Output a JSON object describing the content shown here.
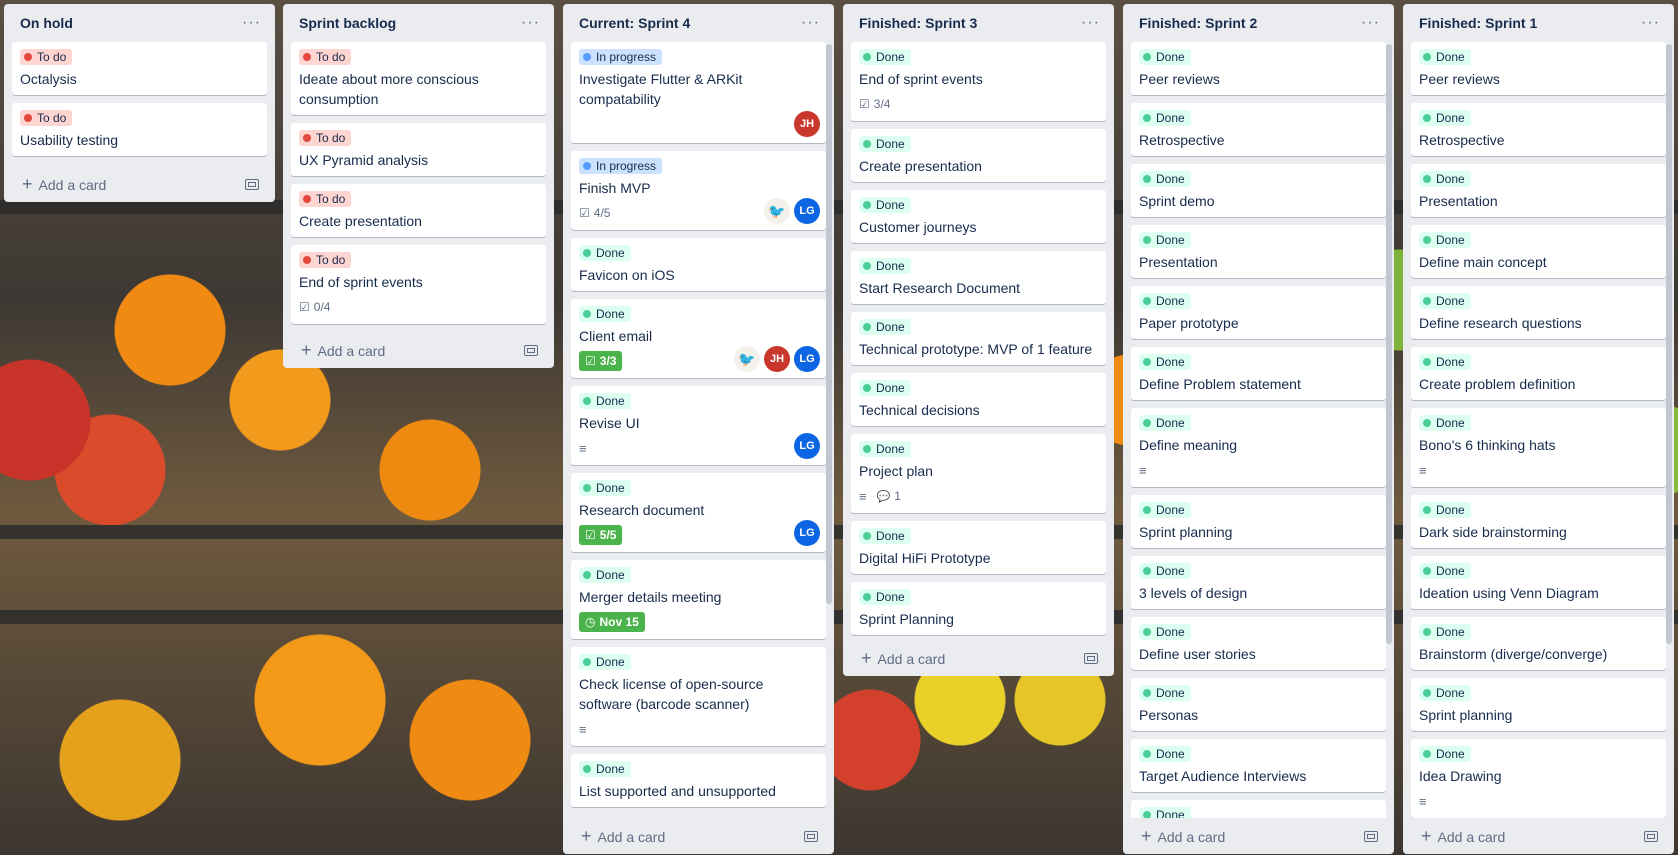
{
  "lists": [
    {
      "title": "On hold",
      "add_card": "Add a card",
      "cards": [
        {
          "label": "To do",
          "label_type": "todo",
          "title": "Octalysis"
        },
        {
          "label": "To do",
          "label_type": "todo",
          "title": "Usability testing"
        }
      ]
    },
    {
      "title": "Sprint backlog",
      "add_card": "Add a card",
      "cards": [
        {
          "label": "To do",
          "label_type": "todo",
          "title": "Ideate about more conscious consumption"
        },
        {
          "label": "To do",
          "label_type": "todo",
          "title": "UX Pyramid analysis"
        },
        {
          "label": "To do",
          "label_type": "todo",
          "title": "Create presentation"
        },
        {
          "label": "To do",
          "label_type": "todo",
          "title": "End of sprint events",
          "checklist": "0/4"
        }
      ]
    },
    {
      "title": "Current: Sprint 4",
      "add_card": "Add a card",
      "cards": [
        {
          "label": "In progress",
          "label_type": "prog",
          "title": "Investigate Flutter & ARKit compatability",
          "members": [
            "JH"
          ]
        },
        {
          "label": "In progress",
          "label_type": "prog",
          "title": "Finish MVP",
          "checklist": "4/5",
          "members": [
            "bird",
            "LG"
          ]
        },
        {
          "label": "Done",
          "label_type": "done",
          "title": "Favicon on iOS"
        },
        {
          "label": "Done",
          "label_type": "done",
          "title": "Client email",
          "checklist_complete": "3/3",
          "members": [
            "bird",
            "JH",
            "LG"
          ]
        },
        {
          "label": "Done",
          "label_type": "done",
          "title": "Revise UI",
          "description": true,
          "members": [
            "LG"
          ]
        },
        {
          "label": "Done",
          "label_type": "done",
          "title": "Research document",
          "checklist_complete": "5/5",
          "members": [
            "LG"
          ]
        },
        {
          "label": "Done",
          "label_type": "done",
          "title": "Merger details meeting",
          "due": "Nov 15"
        },
        {
          "label": "Done",
          "label_type": "done",
          "title": "Check license of open-source software (barcode scanner)",
          "description": true
        },
        {
          "label": "Done",
          "label_type": "done",
          "title": "List supported and unsupported"
        }
      ]
    },
    {
      "title": "Finished: Sprint 3",
      "add_card": "Add a card",
      "cards": [
        {
          "label": "Done",
          "label_type": "done",
          "title": "End of sprint events",
          "checklist": "3/4"
        },
        {
          "label": "Done",
          "label_type": "done",
          "title": "Create presentation"
        },
        {
          "label": "Done",
          "label_type": "done",
          "title": "Customer journeys"
        },
        {
          "label": "Done",
          "label_type": "done",
          "title": "Start Research Document"
        },
        {
          "label": "Done",
          "label_type": "done",
          "title": "Technical prototype: MVP of 1 feature"
        },
        {
          "label": "Done",
          "label_type": "done",
          "title": "Technical decisions"
        },
        {
          "label": "Done",
          "label_type": "done",
          "title": "Project plan",
          "description": true,
          "comments": "1"
        },
        {
          "label": "Done",
          "label_type": "done",
          "title": "Digital HiFi Prototype"
        },
        {
          "label": "Done",
          "label_type": "done",
          "title": "Sprint Planning"
        }
      ]
    },
    {
      "title": "Finished: Sprint 2",
      "add_card": "Add a card",
      "cards": [
        {
          "label": "Done",
          "label_type": "done",
          "title": "Peer reviews"
        },
        {
          "label": "Done",
          "label_type": "done",
          "title": "Retrospective"
        },
        {
          "label": "Done",
          "label_type": "done",
          "title": "Sprint demo"
        },
        {
          "label": "Done",
          "label_type": "done",
          "title": "Presentation"
        },
        {
          "label": "Done",
          "label_type": "done",
          "title": "Paper prototype"
        },
        {
          "label": "Done",
          "label_type": "done",
          "title": "Define Problem statement"
        },
        {
          "label": "Done",
          "label_type": "done",
          "title": "Define meaning",
          "description": true
        },
        {
          "label": "Done",
          "label_type": "done",
          "title": "Sprint planning"
        },
        {
          "label": "Done",
          "label_type": "done",
          "title": "3 levels of design"
        },
        {
          "label": "Done",
          "label_type": "done",
          "title": "Define user stories"
        },
        {
          "label": "Done",
          "label_type": "done",
          "title": "Personas"
        },
        {
          "label": "Done",
          "label_type": "done",
          "title": "Target Audience Interviews"
        },
        {
          "label": "Done",
          "label_type": "done",
          "title": ""
        }
      ]
    },
    {
      "title": "Finished: Sprint 1",
      "add_card": "Add a card",
      "cards": [
        {
          "label": "Done",
          "label_type": "done",
          "title": "Peer reviews"
        },
        {
          "label": "Done",
          "label_type": "done",
          "title": "Retrospective"
        },
        {
          "label": "Done",
          "label_type": "done",
          "title": "Presentation"
        },
        {
          "label": "Done",
          "label_type": "done",
          "title": "Define main concept"
        },
        {
          "label": "Done",
          "label_type": "done",
          "title": "Define research questions"
        },
        {
          "label": "Done",
          "label_type": "done",
          "title": "Create problem definition"
        },
        {
          "label": "Done",
          "label_type": "done",
          "title": "Bono's 6 thinking hats",
          "description": true
        },
        {
          "label": "Done",
          "label_type": "done",
          "title": "Dark side brainstorming"
        },
        {
          "label": "Done",
          "label_type": "done",
          "title": "Ideation using Venn Diagram"
        },
        {
          "label": "Done",
          "label_type": "done",
          "title": "Brainstorm (diverge/converge)"
        },
        {
          "label": "Done",
          "label_type": "done",
          "title": "Sprint planning"
        },
        {
          "label": "Done",
          "label_type": "done",
          "title": "Idea Drawing",
          "description": true
        }
      ]
    }
  ],
  "icons": {
    "menu": "ellipsis-icon",
    "add": "plus-icon",
    "template": "card-template-icon",
    "checklist": "checklist-icon",
    "description": "description-icon",
    "comment": "comment-icon",
    "due": "clock-icon"
  }
}
